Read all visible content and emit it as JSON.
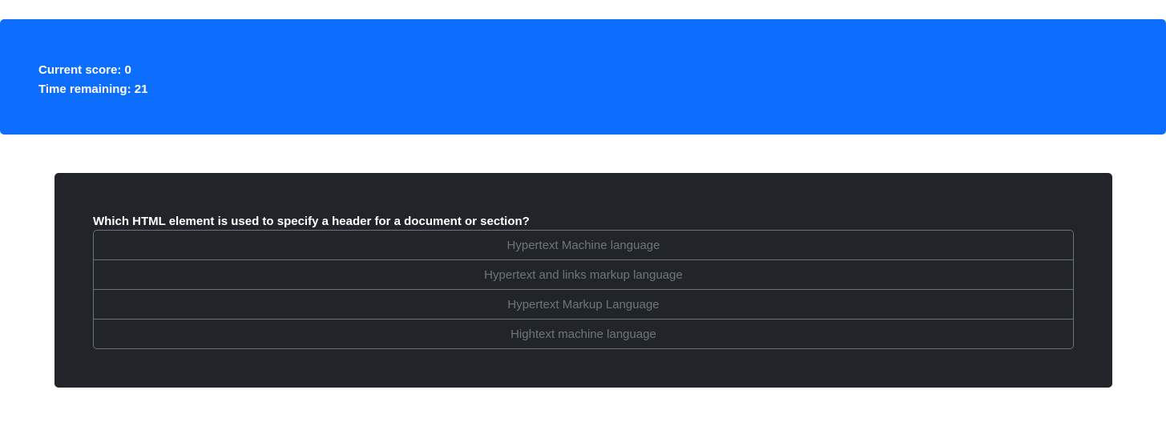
{
  "scoreboard": {
    "score_label": "Current score: 0",
    "time_label": "Time remaining: 21"
  },
  "quiz": {
    "question": "Which HTML element is used to specify a header for a document or section?",
    "answers": [
      "Hypertext Machine language",
      "Hypertext and links markup language",
      "Hypertext Markup Language",
      "Hightext machine language"
    ]
  },
  "colors": {
    "banner": "#0d6efd",
    "card": "#212529",
    "answer_text": "#6c757d"
  }
}
